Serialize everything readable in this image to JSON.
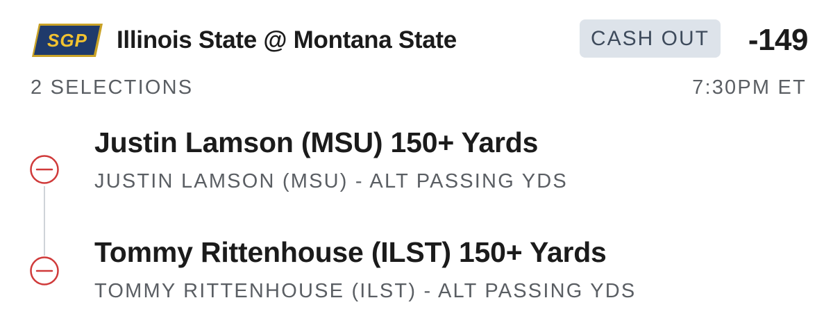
{
  "header": {
    "badge_text": "SGP",
    "matchup": "Illinois State @ Montana State",
    "cash_out_label": "CASH OUT",
    "odds": "-149"
  },
  "subheader": {
    "selections_count": "2 SELECTIONS",
    "game_time": "7:30PM ET"
  },
  "selections": [
    {
      "title": "Justin Lamson (MSU) 150+ Yards",
      "subtitle": "JUSTIN LAMSON (MSU) - ALT PASSING YDS",
      "icon": "minus-circle-icon"
    },
    {
      "title": "Tommy Rittenhouse (ILST) 150+ Yards",
      "subtitle": "TOMMY RITTENHOUSE (ILST) - ALT PASSING YDS",
      "icon": "minus-circle-icon"
    }
  ],
  "colors": {
    "badge_bg": "#1f3a6b",
    "badge_text": "#f2c230",
    "cash_out_bg": "#dde3ea",
    "remove_icon": "#d03a3a",
    "connector": "#cfd3d8"
  }
}
